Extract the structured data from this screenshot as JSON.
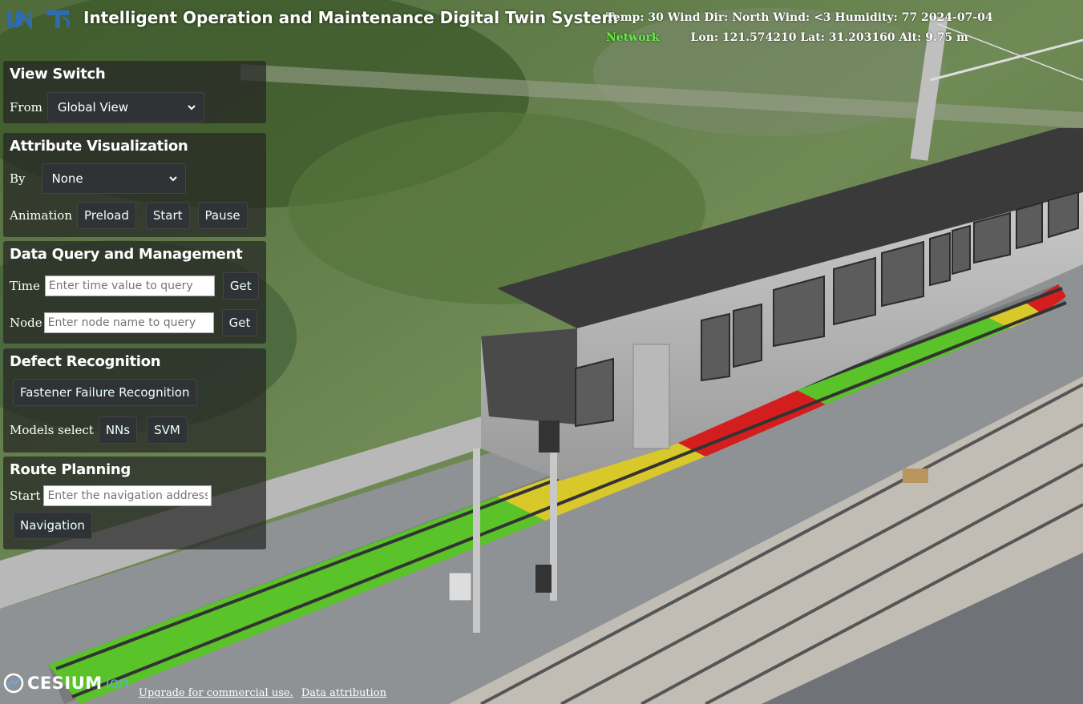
{
  "header": {
    "title": "Intelligent Operation and Maintenance Digital Twin System",
    "weather": "Temp: 30 Wind Dir: North Wind: <3 Humidity: 77 2024-07-04",
    "network": "Network",
    "coords": "Lon: 121.574210 Lat: 31.203160 Alt: 9.75 m",
    "logos": [
      "UN",
      "TJ"
    ],
    "network_color": "#66ee44"
  },
  "view_switch": {
    "title": "View Switch",
    "from_label": "From",
    "selected": "Global View"
  },
  "attribute_visualization": {
    "title": "Attribute Visualization",
    "by_label": "By",
    "selected": "None",
    "animation_label": "Animation",
    "buttons": {
      "preload": "Preload",
      "start": "Start",
      "pause": "Pause"
    }
  },
  "data_query": {
    "title": "Data Query and Management",
    "time_label": "Time",
    "time_placeholder": "Enter time value to query",
    "time_button": "Get",
    "node_label": "Node",
    "node_placeholder": "Enter node name to query",
    "node_button": "Get"
  },
  "defect_recognition": {
    "title": "Defect Recognition",
    "recognize_button": "Fastener Failure Recognition",
    "models_label": "Models select",
    "models": [
      "NNs",
      "SVM"
    ]
  },
  "route_planning": {
    "title": "Route Planning",
    "start_label": "Start",
    "start_placeholder": "Enter the navigation address",
    "navigation_button": "Navigation"
  },
  "footer": {
    "brand": "CESIUM",
    "brand_suffix": "ion",
    "upgrade_link": "Upgrade for commercial use.",
    "attribution_link": "Data attribution"
  },
  "colors": {
    "panel_bg": "rgba(38,38,38,0.72)",
    "button_bg": "#303336",
    "track_good": "#5ac32a",
    "track_warn": "#d8c82a",
    "track_bad": "#d41e1e"
  }
}
